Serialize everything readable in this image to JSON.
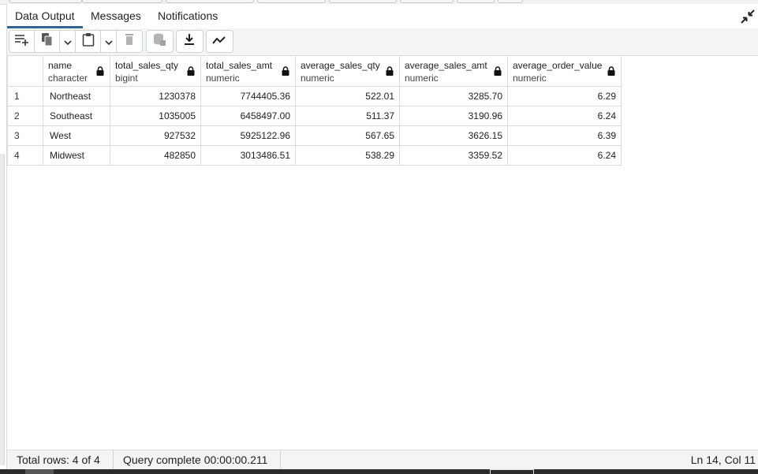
{
  "tabs": [
    {
      "label": "Data Output",
      "active": true
    },
    {
      "label": "Messages",
      "active": false
    },
    {
      "label": "Notifications",
      "active": false
    }
  ],
  "toolbar": {
    "icons": [
      "add-row-icon",
      "copy-icon",
      "chevron-down-icon",
      "paste-icon",
      "chevron-down-icon",
      "delete-icon",
      "save-data-icon",
      "download-icon",
      "graph-visualiser-icon"
    ]
  },
  "grid": {
    "columns": [
      {
        "name": "name",
        "type": "character",
        "align": "left"
      },
      {
        "name": "total_sales_qty",
        "type": "bigint",
        "align": "right"
      },
      {
        "name": "total_sales_amt",
        "type": "numeric",
        "align": "right"
      },
      {
        "name": "average_sales_qty",
        "type": "numeric",
        "align": "right"
      },
      {
        "name": "average_sales_amt",
        "type": "numeric",
        "align": "right"
      },
      {
        "name": "average_order_value",
        "type": "numeric",
        "align": "right"
      }
    ],
    "rows": [
      {
        "num": "1",
        "cells": [
          "Northeast",
          "1230378",
          "7744405.36",
          "522.01",
          "3285.70",
          "6.29"
        ]
      },
      {
        "num": "2",
        "cells": [
          "Southeast",
          "1035005",
          "6458497.00",
          "511.37",
          "3190.96",
          "6.24"
        ]
      },
      {
        "num": "3",
        "cells": [
          "West",
          "927532",
          "5925122.96",
          "567.65",
          "3626.15",
          "6.39"
        ]
      },
      {
        "num": "4",
        "cells": [
          "Midwest",
          "482850",
          "3013486.51",
          "538.29",
          "3359.52",
          "6.24"
        ]
      }
    ]
  },
  "status": {
    "total_rows": "Total rows: 4 of 4",
    "query": "Query complete 00:00:00.211",
    "cursor": "Ln 14, Col 11"
  },
  "colors": {
    "accent": "#326690",
    "toolbar_bg": "#f3f4f6",
    "border": "#dcdcdc"
  }
}
